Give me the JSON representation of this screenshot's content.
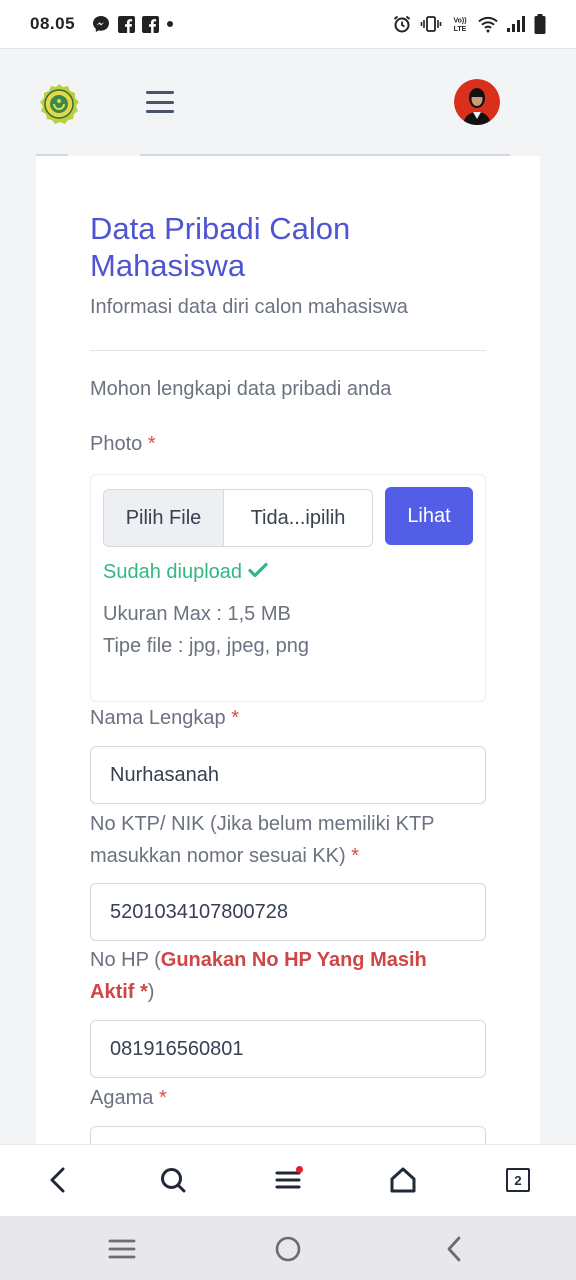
{
  "status_bar": {
    "time": "08.05",
    "left_icons": [
      "messenger-icon",
      "facebook-icon",
      "facebook-icon",
      "dot-icon"
    ],
    "right_icons": [
      "alarm-icon",
      "vibrate-icon",
      "volte-icon",
      "wifi-icon",
      "signal-icon",
      "battery-icon"
    ],
    "volte_text": "Vo)) LTE"
  },
  "header": {
    "logo": "university-seal-logo",
    "menu_icon": "hamburger-icon",
    "avatar": "user-avatar"
  },
  "form": {
    "title": "Data Pribadi Calon Mahasiswa",
    "subtitle": "Informasi data diri calon mahasiswa",
    "intro": "Mohon lengkapi data pribadi anda",
    "photo": {
      "label": "Photo",
      "required_mark": "*",
      "choose_file_label": "Pilih File",
      "file_name": "Tida...ipilih",
      "view_button": "Lihat",
      "uploaded_text": "Sudah diupload",
      "max_size": "Ukuran Max : 1,5 MB",
      "file_types": "Tipe file : jpg, jpeg, png"
    },
    "nama": {
      "label": "Nama Lengkap",
      "required_mark": "*",
      "value": "Nurhasanah"
    },
    "nik": {
      "label_line1": "No KTP/ NIK (Jika belum memiliki KTP",
      "label_line2": "masukkan nomor sesuai KK)",
      "required_mark": "*",
      "value": "5201034107800728"
    },
    "hp": {
      "label_prefix": "No HP (",
      "warning_line1": "Gunakan No HP Yang Masih",
      "warning_line2": "Aktif *",
      "label_suffix": ")",
      "value": "081916560801"
    },
    "agama": {
      "label": "Agama",
      "required_mark": "*"
    }
  },
  "browser_bar": {
    "buttons": [
      "back-icon",
      "search-icon",
      "menu-icon",
      "home-icon",
      "tabs-icon"
    ],
    "tab_count": "2"
  },
  "nav_bar": {
    "buttons": [
      "recents-icon",
      "home-circle-icon",
      "back-icon"
    ]
  },
  "colors": {
    "accent": "#525ee6",
    "title": "#4f55d2",
    "success": "#2fb981",
    "danger": "#dc4a4a"
  }
}
